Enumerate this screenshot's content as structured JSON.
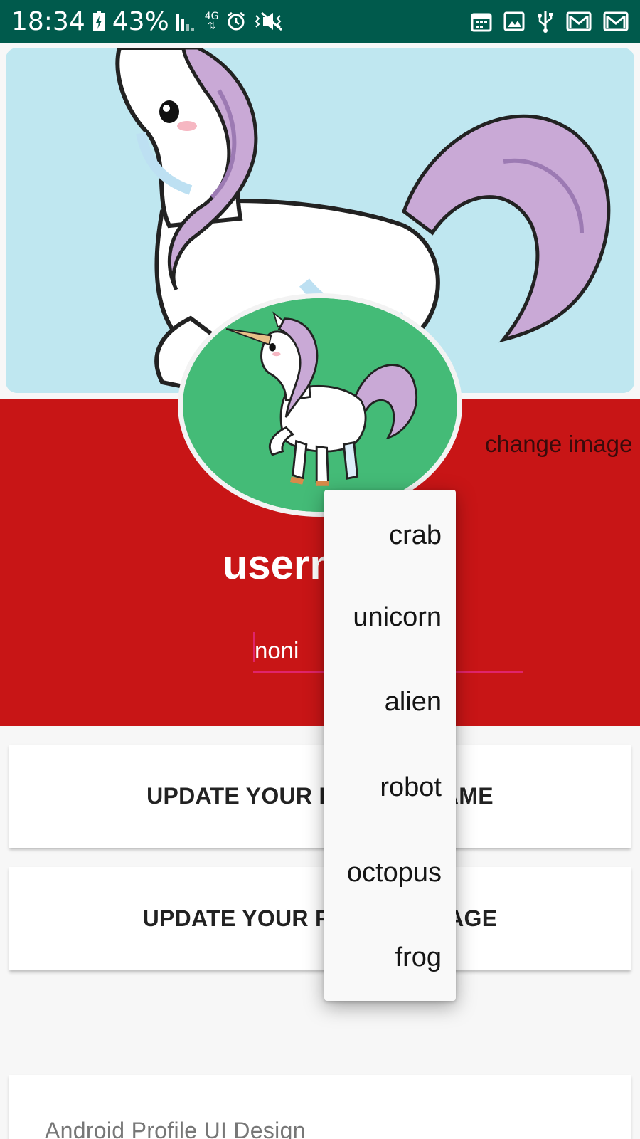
{
  "status_bar": {
    "time": "18:34",
    "battery": "43%",
    "network": "4G",
    "icons": [
      "battery-charging-icon",
      "signal-icon",
      "network-4g-icon",
      "alarm-icon",
      "mute-icon",
      "calendar-icon",
      "image-icon",
      "usb-icon",
      "mail-icon",
      "mail-icon"
    ]
  },
  "profile": {
    "change_image_label": "change image",
    "username_label": "username",
    "name_input_value": "noni"
  },
  "cards": {
    "update_name_label": "UPDATE YOUR PROFILE NAME",
    "update_image_label": "UPDATE YOUR PROFILE IMAGE",
    "info_text": "Android Profile UI Design"
  },
  "dropdown": {
    "items": [
      "crab",
      "unicorn",
      "alien",
      "robot",
      "octopus",
      "frog"
    ]
  },
  "colors": {
    "status_bar": "#005a4c",
    "band": "#c81516",
    "avatar_bg": "#44bb77",
    "cover_bg": "#bfe7f0"
  }
}
